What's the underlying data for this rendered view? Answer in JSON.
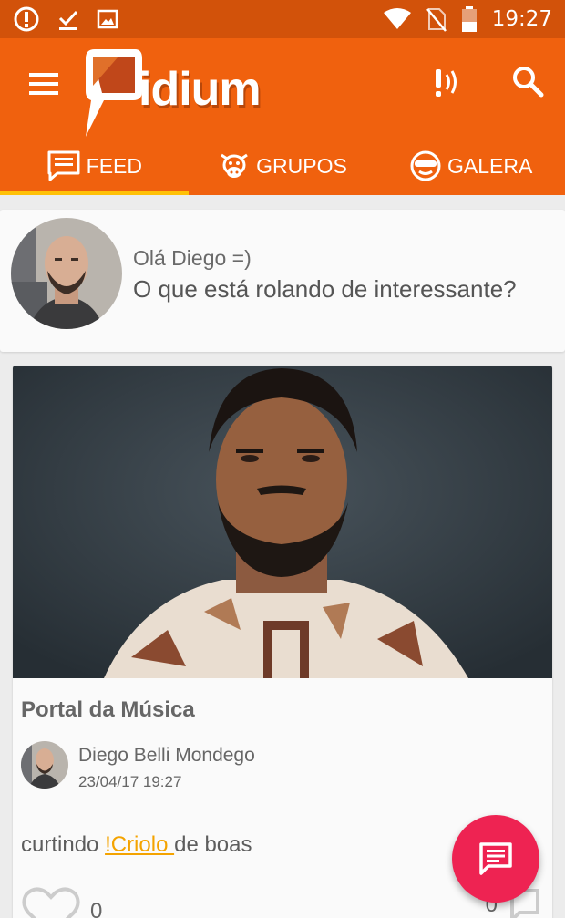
{
  "status_bar": {
    "time": "19:27",
    "icons": [
      "alert-circle-icon",
      "download-done-icon",
      "image-icon",
      "wifi-icon",
      "no-sim-icon",
      "battery-icon"
    ]
  },
  "app_bar": {
    "logo_text": "idium",
    "brand_color": "#f0610e",
    "tabs": [
      {
        "label": "FEED",
        "icon": "feed-icon",
        "active": true
      },
      {
        "label": "GRUPOS",
        "icon": "cow-icon",
        "active": false
      },
      {
        "label": "GALERA",
        "icon": "sunglasses-face-icon",
        "active": false
      }
    ]
  },
  "composer": {
    "greeting": "Olá Diego =)",
    "prompt": "O que está rolando de interessante?"
  },
  "post": {
    "title": "Portal da Música",
    "author": "Diego Belli Mondego",
    "date": "23/04/17 19:27",
    "text_before": "curtindo ",
    "mention": "!Criolo ",
    "text_after": "de boas",
    "likes": "0",
    "comments": "0"
  },
  "colors": {
    "accent": "#ffc107",
    "fab": "#ee2352",
    "mention": "#f4a300"
  }
}
